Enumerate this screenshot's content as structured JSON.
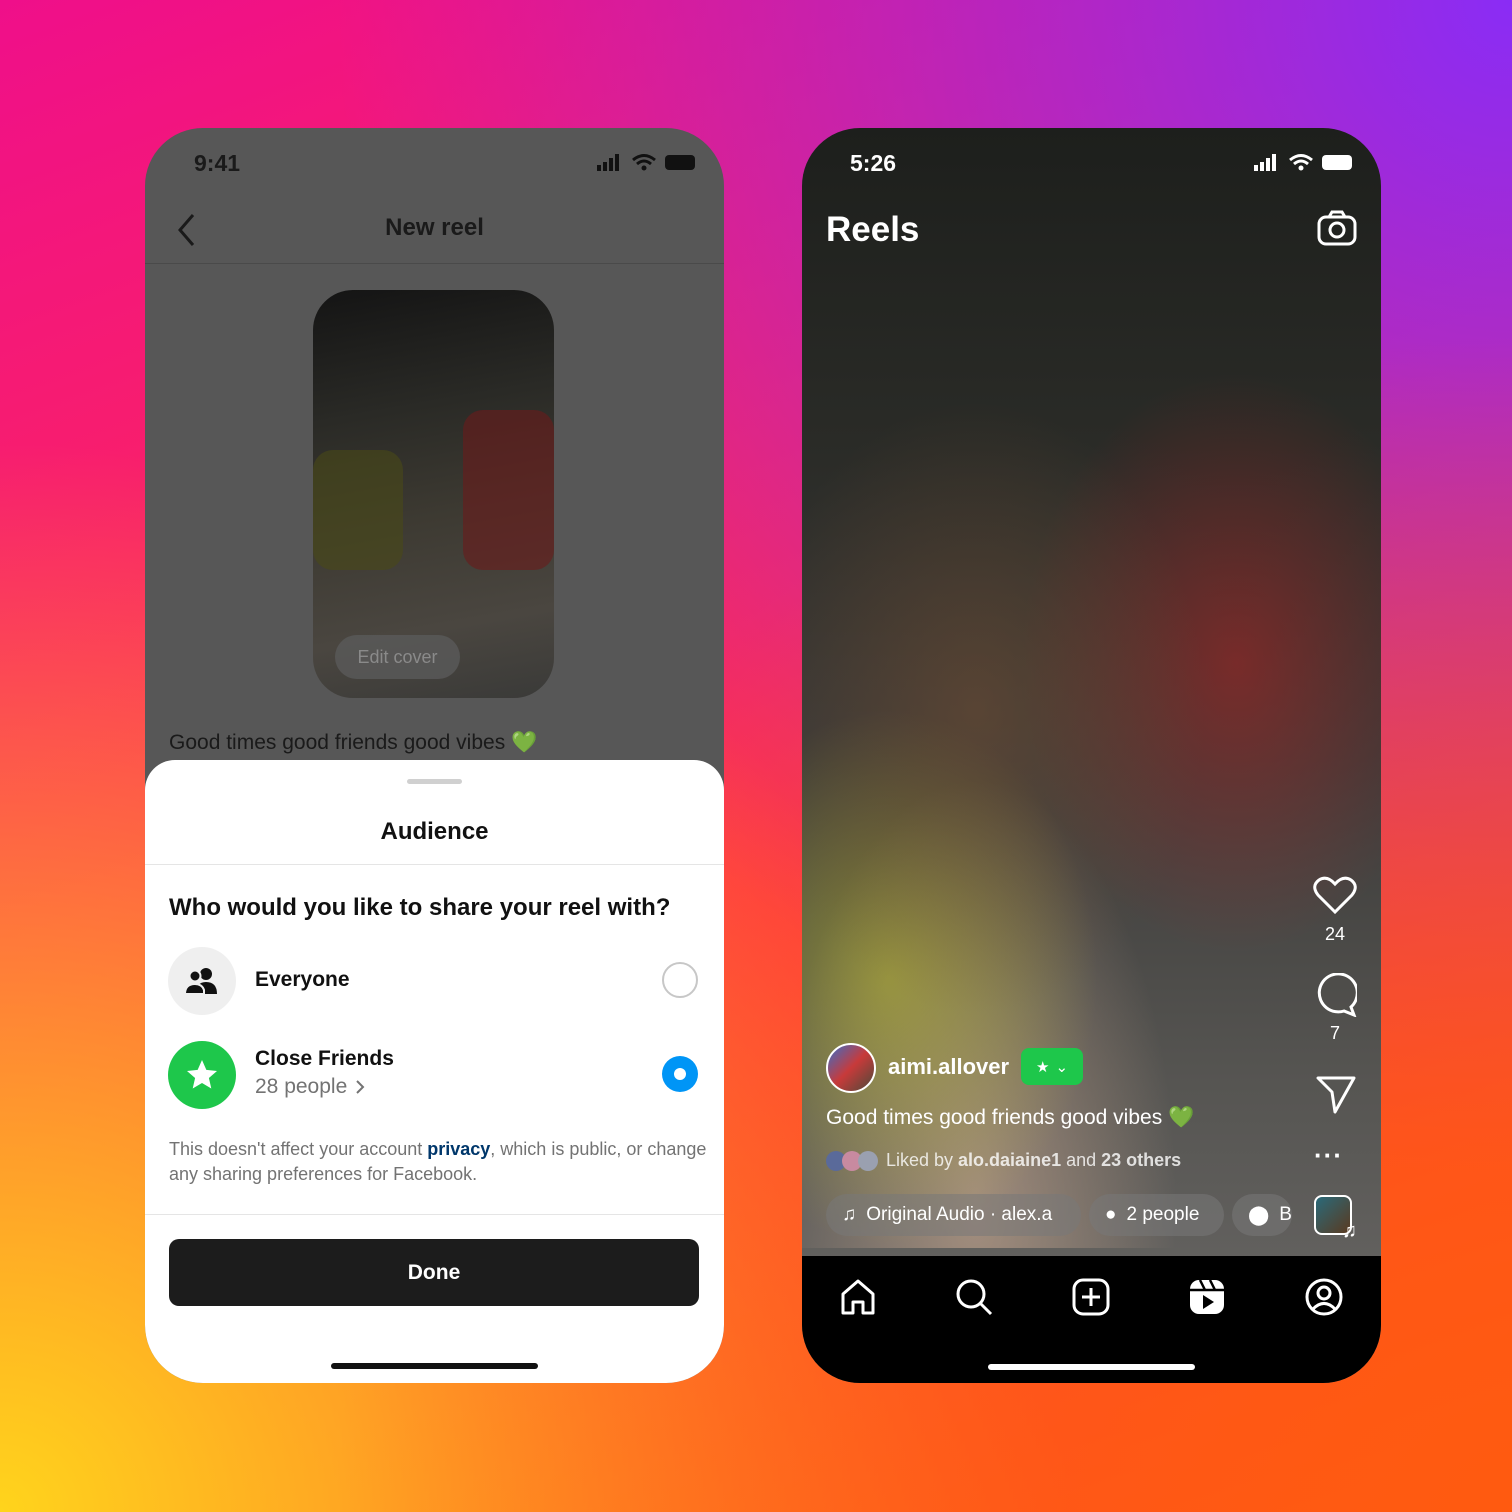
{
  "left_phone": {
    "status_time": "9:41",
    "header_title": "New reel",
    "edit_cover_label": "Edit cover",
    "caption": "Good times good friends good vibes 💚",
    "sheet": {
      "title": "Audience",
      "question": "Who would you like to share your reel with?",
      "options": [
        {
          "label": "Everyone",
          "icon": "people-icon",
          "selected": false
        },
        {
          "label": "Close Friends",
          "sublabel": "28 people",
          "icon": "star-icon",
          "selected": true
        }
      ],
      "note_before": "This doesn't affect your account ",
      "note_link": "privacy",
      "note_after": ", which is public, or change any sharing preferences for Facebook.",
      "done_label": "Done"
    },
    "colors": {
      "accent_blue": "#0095f6",
      "close_friends_green": "#1ec74b",
      "link": "#00376b"
    }
  },
  "right_phone": {
    "status_time": "5:26",
    "title": "Reels",
    "likes_count": "24",
    "comments_count": "7",
    "username": "aimi.allover",
    "caption": "Good times good friends good vibes 💚",
    "liked_prefix": "Liked by ",
    "liked_user": "alo.daiaine1",
    "liked_mid": " and ",
    "liked_others": "23 others",
    "audio_label": "Original Audio · alex.a",
    "people_label": "2 people",
    "location_label": "Br",
    "nav": [
      "home-icon",
      "search-icon",
      "create-icon",
      "reels-icon",
      "profile-icon"
    ]
  }
}
